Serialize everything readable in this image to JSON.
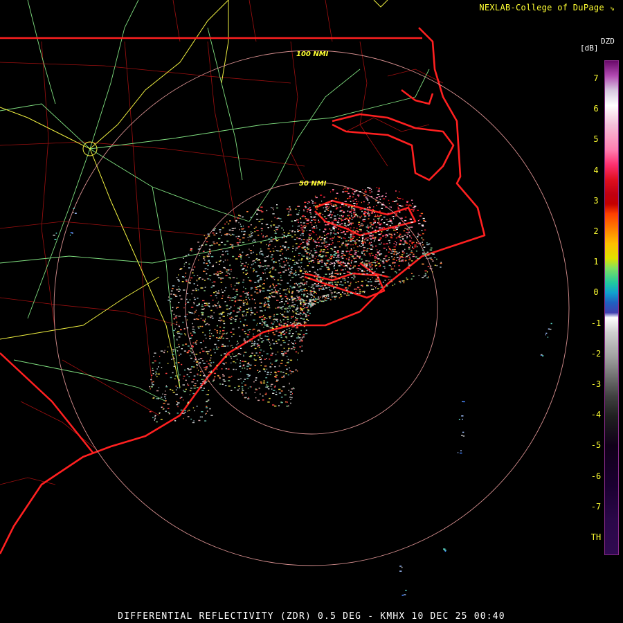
{
  "header": {
    "credit": "NEXLAB-College of DuPage"
  },
  "range_rings": [
    {
      "label": "50 NMI"
    },
    {
      "label": "100 NMI"
    }
  ],
  "legend": {
    "product": "DZD",
    "unit": "[dB]",
    "ticks": [
      "7",
      "6",
      "5",
      "4",
      "3",
      "2",
      "1",
      "0",
      "-1",
      "-2",
      "-3",
      "-4",
      "-5",
      "-6",
      "-7",
      "TH"
    ]
  },
  "footer": {
    "caption": "DIFFERENTIAL REFLECTIVITY (ZDR) 0.5 DEG - KMHX 10 DEC 25 00:40"
  },
  "colors": {
    "state_border": "#ff2020",
    "county_line": "#a01010",
    "highway_major": "#f0f040",
    "highway_minor": "#80e080",
    "range_ring": "#d89090",
    "label": "#ffff33"
  }
}
